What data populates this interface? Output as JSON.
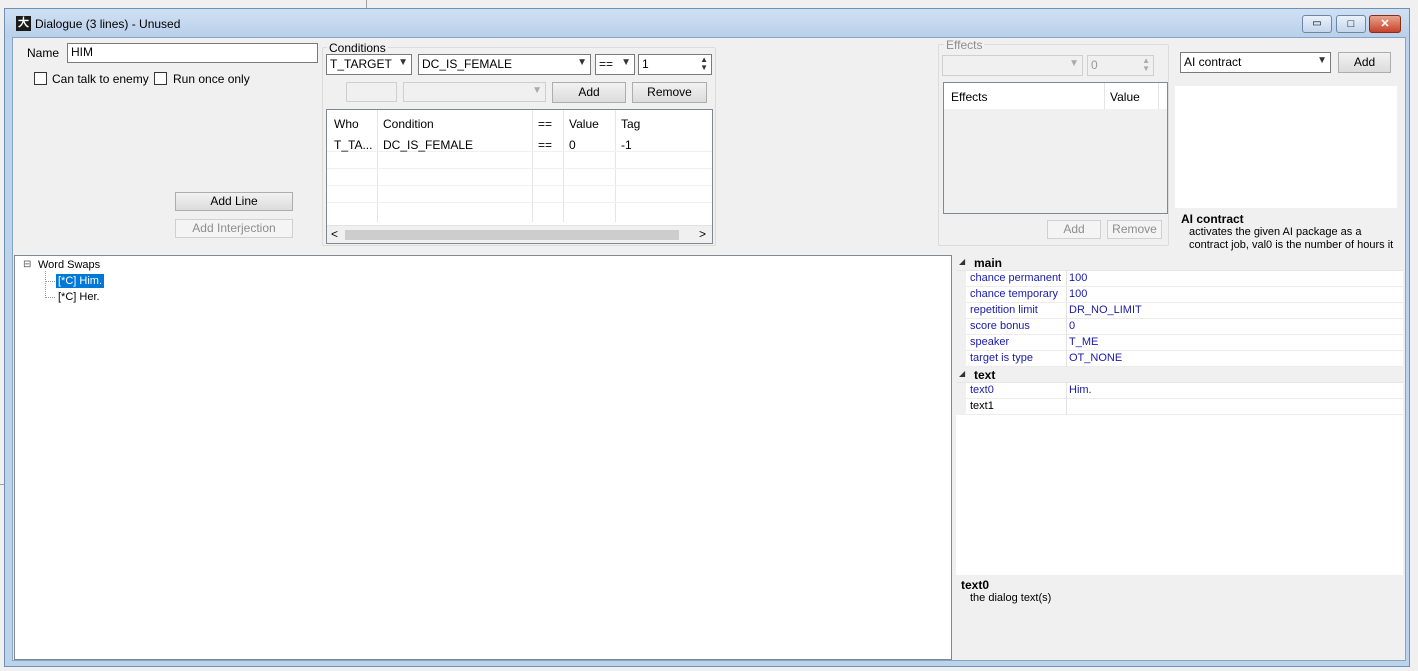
{
  "window": {
    "title": "Dialogue (3 lines) - Unused",
    "icon_glyph": "大",
    "minimize_glyph": "▭",
    "maximize_glyph": "□",
    "close_glyph": "✕"
  },
  "name_field": {
    "label": "Name",
    "value": "HIM"
  },
  "checkboxes": {
    "can_talk_to_enemy": "Can talk to enemy",
    "run_once_only": "Run once only"
  },
  "buttons": {
    "add_line": "Add Line",
    "add_interjection": "Add Interjection"
  },
  "conditions": {
    "group_label": "Conditions",
    "who_value": "T_TARGET",
    "condition_value": "DC_IS_FEMALE",
    "operator_value": "==",
    "value": "1",
    "add_label": "Add",
    "remove_label": "Remove",
    "columns": [
      "Who",
      "Condition",
      "==",
      "Value",
      "Tag"
    ],
    "rows": [
      [
        "T_TA...",
        "DC_IS_FEMALE",
        "==",
        "0",
        "-1"
      ]
    ],
    "scroll_left": "<",
    "scroll_right": ">"
  },
  "effects": {
    "group_label": "Effects",
    "value": "0",
    "columns": [
      "Effects",
      "Value"
    ],
    "add_label": "Add",
    "remove_label": "Remove"
  },
  "ai": {
    "selected": "AI contract",
    "add_label": "Add",
    "desc_title": "AI contract",
    "desc_text_line1": "activates the given AI package as a",
    "desc_text_line2": "contract job, val0 is the number of hours it"
  },
  "tree": {
    "root": "Word Swaps",
    "expander": "⊟",
    "children": [
      "[*C] Him.",
      "[*C] Her."
    ]
  },
  "properties": {
    "main_label": "main",
    "main_rows": [
      {
        "name": "chance permanent",
        "value": "100"
      },
      {
        "name": "chance temporary",
        "value": "100"
      },
      {
        "name": "repetition limit",
        "value": "DR_NO_LIMIT"
      },
      {
        "name": "score bonus",
        "value": "0"
      },
      {
        "name": "speaker",
        "value": "T_ME"
      },
      {
        "name": "target is type",
        "value": "OT_NONE"
      }
    ],
    "text_label": "text",
    "text_rows": [
      {
        "name": "text0",
        "value": "Him."
      },
      {
        "name": "text1",
        "value": ""
      }
    ],
    "collapse_glyph": "◢",
    "desc_title": "text0",
    "desc_text": "the dialog text(s)"
  }
}
